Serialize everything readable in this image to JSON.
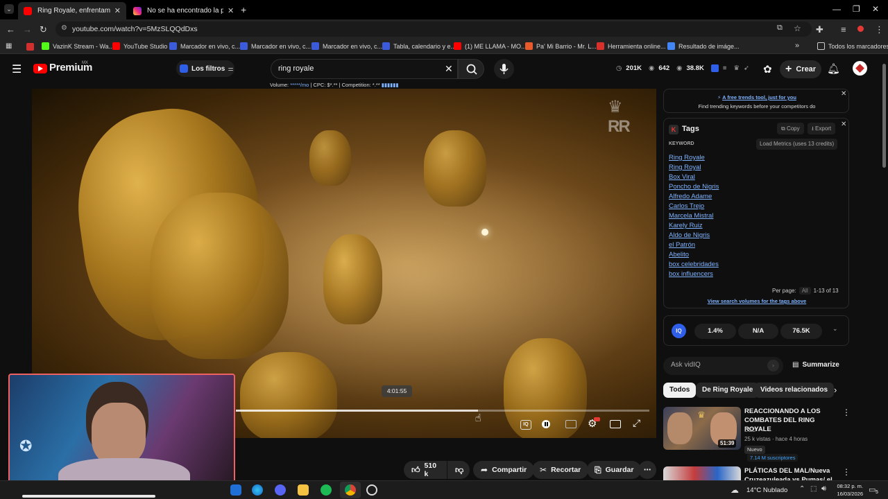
{
  "browser": {
    "tabs": [
      {
        "title": "Ring Royale, enfrentamientos E",
        "color": "#ff0000",
        "active": true
      },
      {
        "title": "No se ha encontrado la página",
        "color": "#c13584",
        "active": false
      }
    ],
    "url": "youtube.com/watch?v=5MzSLQQdDxs",
    "bookmarks": [
      {
        "label": "VazinK Stream - Wa...",
        "color": "#53fc18"
      },
      {
        "label": "YouTube Studio",
        "color": "#ff0000"
      },
      {
        "label": "Marcador en vivo, c...",
        "color": "#3b5bdb"
      },
      {
        "label": "Marcador en vivo, c...",
        "color": "#3b5bdb"
      },
      {
        "label": "Marcador en vivo, c...",
        "color": "#3b5bdb"
      },
      {
        "label": "Tabla, calendario y e...",
        "color": "#3b5bdb"
      },
      {
        "label": "(1) ME LLAMA - MO...",
        "color": "#ff0000"
      },
      {
        "label": "Pa' Mi Barrio - Mr. L...",
        "color": "#e8592b"
      },
      {
        "label": "Herramienta online...",
        "color": "#d9302c"
      },
      {
        "label": "Resultado de imáge...",
        "color": "#4285f4"
      }
    ],
    "all_bookmarks": "Todos los marcadores"
  },
  "yt": {
    "logo": "Premium",
    "region": "MX",
    "filters": "Los filtros",
    "search_value": "ring royale",
    "seo_line": {
      "volume": "Volume:",
      "volume_val": "*****/mo",
      "cpc": "| CPC:",
      "cpc_val": "$*.**",
      "comp": "| Competition:",
      "comp_val": "*.**"
    },
    "stats": [
      "201K",
      "642",
      "38.8K"
    ],
    "create": "Crear"
  },
  "player": {
    "time_tooltip": "4:01:55",
    "progress": 0.585
  },
  "vidiq": {
    "promo_link": "A free trends tool, just for you",
    "promo_sub": "Find trending keywords before your competitors do",
    "tags_title": "Tags",
    "copy": "Copy",
    "export": "Export",
    "keyword_header": "KEYWORD",
    "load_metrics": "Load Metrics (uses 13 credits)",
    "tags": [
      "Ring Royale",
      "Ring Royal",
      "Box Viral",
      "Poncho de Nigris",
      "Alfredo Adame",
      "Carlos Trejo",
      "Marcela Mistral",
      "Karely Ruiz",
      "Aldo de Nigris",
      "el Patrón",
      "Abelito",
      "box celebridades",
      "box influencers"
    ],
    "per_page": "Per page:",
    "per_page_val": "All",
    "range": "1-13 of 13",
    "view_volumes": "View search volumes for the tags above",
    "metrics": [
      "1.4%",
      "N/A",
      "76.5K"
    ],
    "ask": "Ask vidIQ",
    "summarize": "Summarize"
  },
  "chips": [
    "Todos",
    "De Ring Royale",
    "Videos relacionados"
  ],
  "related": [
    {
      "title1": "REACCIONANDO A LOS",
      "title2": "COMBATES DEL RING ROYALE",
      "channel": "DED",
      "meta": "25 k vistas · hace 4 horas",
      "badge": "Nuevo",
      "subs": "7.14 M suscriptores",
      "duration": "51:39"
    },
    {
      "title1": "PLÁTICAS DEL MAL/Nueva",
      "title2": "Cruzeazuleada vs Pumas/ el"
    }
  ],
  "actions": {
    "likes": "510 k",
    "share": "Compartir",
    "clip": "Recortar",
    "save": "Guardar"
  },
  "taskbar": {
    "weather": "14°C  Nublado",
    "time": "08:32 p. m.",
    "date": "16/03/2026",
    "notif": "5"
  }
}
